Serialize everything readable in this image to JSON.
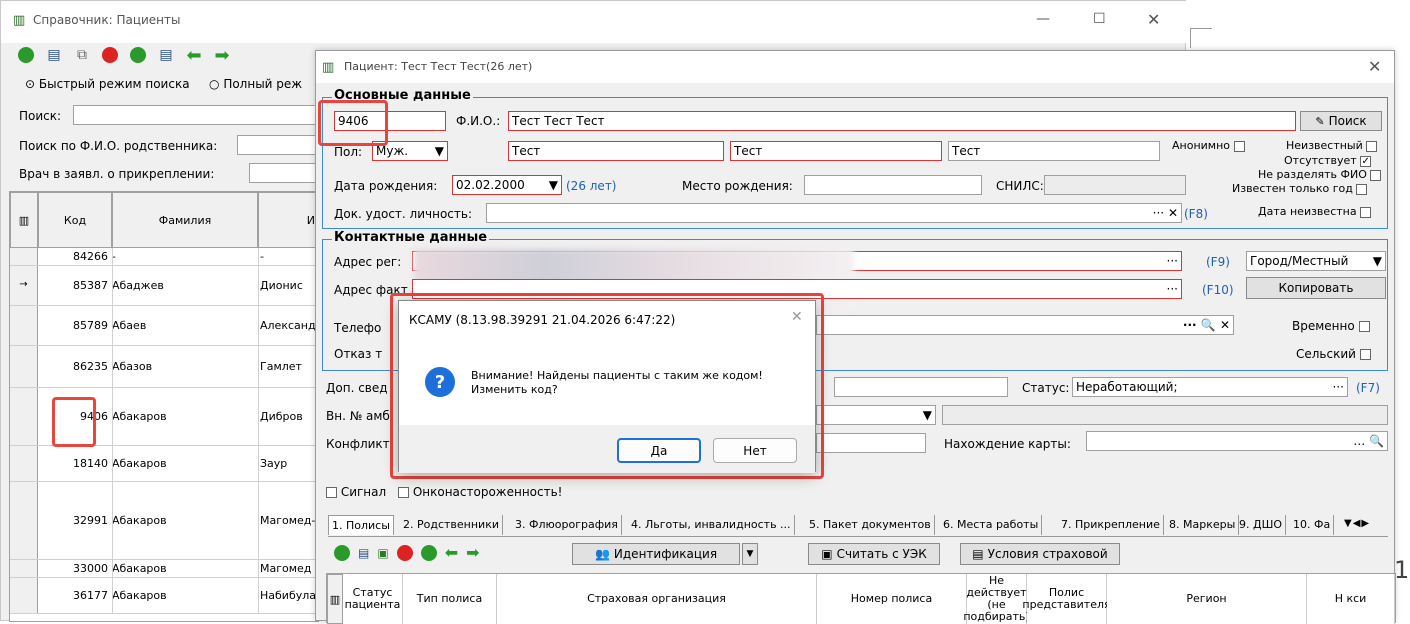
{
  "bg_window": {
    "title": "Справочник: Пациенты",
    "search_mode_fast": "Быстрый режим поиска",
    "search_mode_full": "Полный реж",
    "search_label": "Поиск:",
    "relative_search_label": "Поиск по Ф.И.О. родственника:",
    "doctor_label": "Врач в заявл. о прикреплении:",
    "grid": {
      "columns": [
        "Код",
        "Фамилия",
        "И"
      ],
      "rows": [
        {
          "code": "84266",
          "surname": "-",
          "name": "-"
        },
        {
          "code": "85387",
          "surname": "Абаджев",
          "name": "Дионис"
        },
        {
          "code": "85789",
          "surname": "Абаев",
          "name": "Александ"
        },
        {
          "code": "86235",
          "surname": "Абазов",
          "name": "Гамлет"
        },
        {
          "code": "9406",
          "surname": "Абакаров",
          "name": "Дибров"
        },
        {
          "code": "18140",
          "surname": "Абакаров",
          "name": "Заур"
        },
        {
          "code": "32991",
          "surname": "Абакаров",
          "name": "Магомед-"
        },
        {
          "code": "33000",
          "surname": "Абакаров",
          "name": "Магомед"
        },
        {
          "code": "36177",
          "surname": "Абакаров",
          "name": "Набибула"
        }
      ]
    }
  },
  "patient_window": {
    "title": "Пациент: Тест Тест Тест(26 лет)",
    "basic_group": "Основные данные",
    "code_value": "9406",
    "fio_label": "Ф.И.О.:",
    "fio_value": "Тест Тест Тест",
    "search_button": "Поиск",
    "sex_label": "Пол:",
    "sex_value": "Муж.",
    "surname_value": "Тест",
    "name_value": "Тест",
    "patronymic_value": "Тест",
    "anonymous_label": "Анонимно",
    "unknown_label": "Неизвестный",
    "absent_label": "Отсутствует",
    "no_split_label": "Не разделять ФИО",
    "year_only_label": "Известен только год",
    "date_unknown_label": "Дата неизвестна",
    "birthdate_label": "Дата рождения:",
    "birthdate_value": "02.02.2000",
    "age_text": "(26 лет)",
    "birthplace_label": "Место рождения:",
    "snils_label": "СНИЛС:",
    "id_doc_label": "Док. удост. личность:",
    "f8": "(F8)",
    "contact_group": "Контактные данные",
    "reg_address_label": "Адрес рег:",
    "f9": "(F9)",
    "city_value": "Город/Местный",
    "fact_address_label": "Адрес факт",
    "f10": "(F10)",
    "copy_button": "Копировать",
    "phone_label": "Телефо",
    "temporary_label": "Временно",
    "refusal_label": "Отказ т",
    "rural_label": "Сельский",
    "extra_label": "Доп. свед",
    "status_label": "Статус:",
    "status_value": "Неработающий;",
    "f7": "(F7)",
    "amb_label": "Вн. № амб",
    "conflict_label": "Конфликт",
    "card_location_label": "Нахождение карты:",
    "signal_label": "Сигнал",
    "onco_label": "Онконастороженность!",
    "tabs": [
      "1. Полисы",
      "2. Родственники",
      "3. Флюорография",
      "4. Льготы, инвалидность ...",
      "5. Пакет документов",
      "6. Места работы",
      "7. Прикрепление",
      "8. Маркеры",
      "9. ДШО",
      "10. Фа"
    ],
    "ident_button": "Идентификация",
    "read_uek_button": "Считать с УЭК",
    "insurance_conditions_button": "Условия страховой",
    "policy_columns": [
      "Статус пациента",
      "Тип полиса",
      "Страховая организация",
      "Номер полиса",
      "Не действует (не подбирать)",
      "Полис представителя",
      "Регион",
      "Н кси"
    ]
  },
  "dialog": {
    "title": "КСАМУ (8.13.98.39291 21.04.2026 6:47:22)",
    "message_line1": "Внимание! Найдены пациенты с таким же кодом!",
    "message_line2": "Изменить код?",
    "yes_button": "Да",
    "no_button": "Нет"
  },
  "edge_text": "1",
  "colors": {
    "highlight": "#e8453c",
    "group_border": "#3d8ad8",
    "info_icon": "#1e6fd9"
  }
}
